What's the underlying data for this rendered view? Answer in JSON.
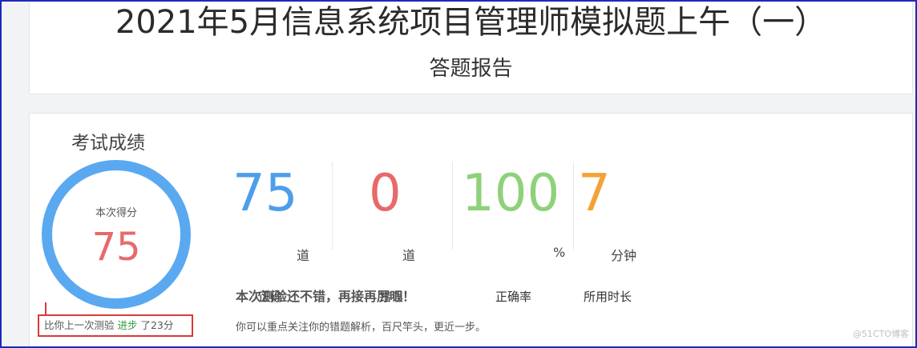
{
  "header": {
    "title": "2021年5月信息系统项目管理师模拟题上午（一）",
    "subtitle": "答题报告"
  },
  "score": {
    "section_title": "考试成绩",
    "ring_caption": "本次得分",
    "value": "75",
    "ring_color": "#5aa9f0",
    "score_color": "#e8696a"
  },
  "comparison": {
    "prefix": "比你上一次测验 ",
    "improvement_word": "进步",
    "suffix": " 了23分"
  },
  "stats": [
    {
      "value": "75",
      "unit": "道",
      "label": "正确",
      "color": "#4e9eea"
    },
    {
      "value": "0",
      "unit": "道",
      "label": "错误",
      "color": "#e8696a"
    },
    {
      "value": "100",
      "unit": "%",
      "label": "正确率",
      "color": "#8ed17b"
    },
    {
      "value": "7",
      "unit": "分钟",
      "label": "所用时长",
      "color": "#f4a236"
    }
  ],
  "feedback": {
    "headline": "本次测验还不错，再接再厉吧！",
    "advice": "你可以重点关注你的错题解析，百尺竿头，更近一步。"
  },
  "watermark": "@51CTO博客"
}
